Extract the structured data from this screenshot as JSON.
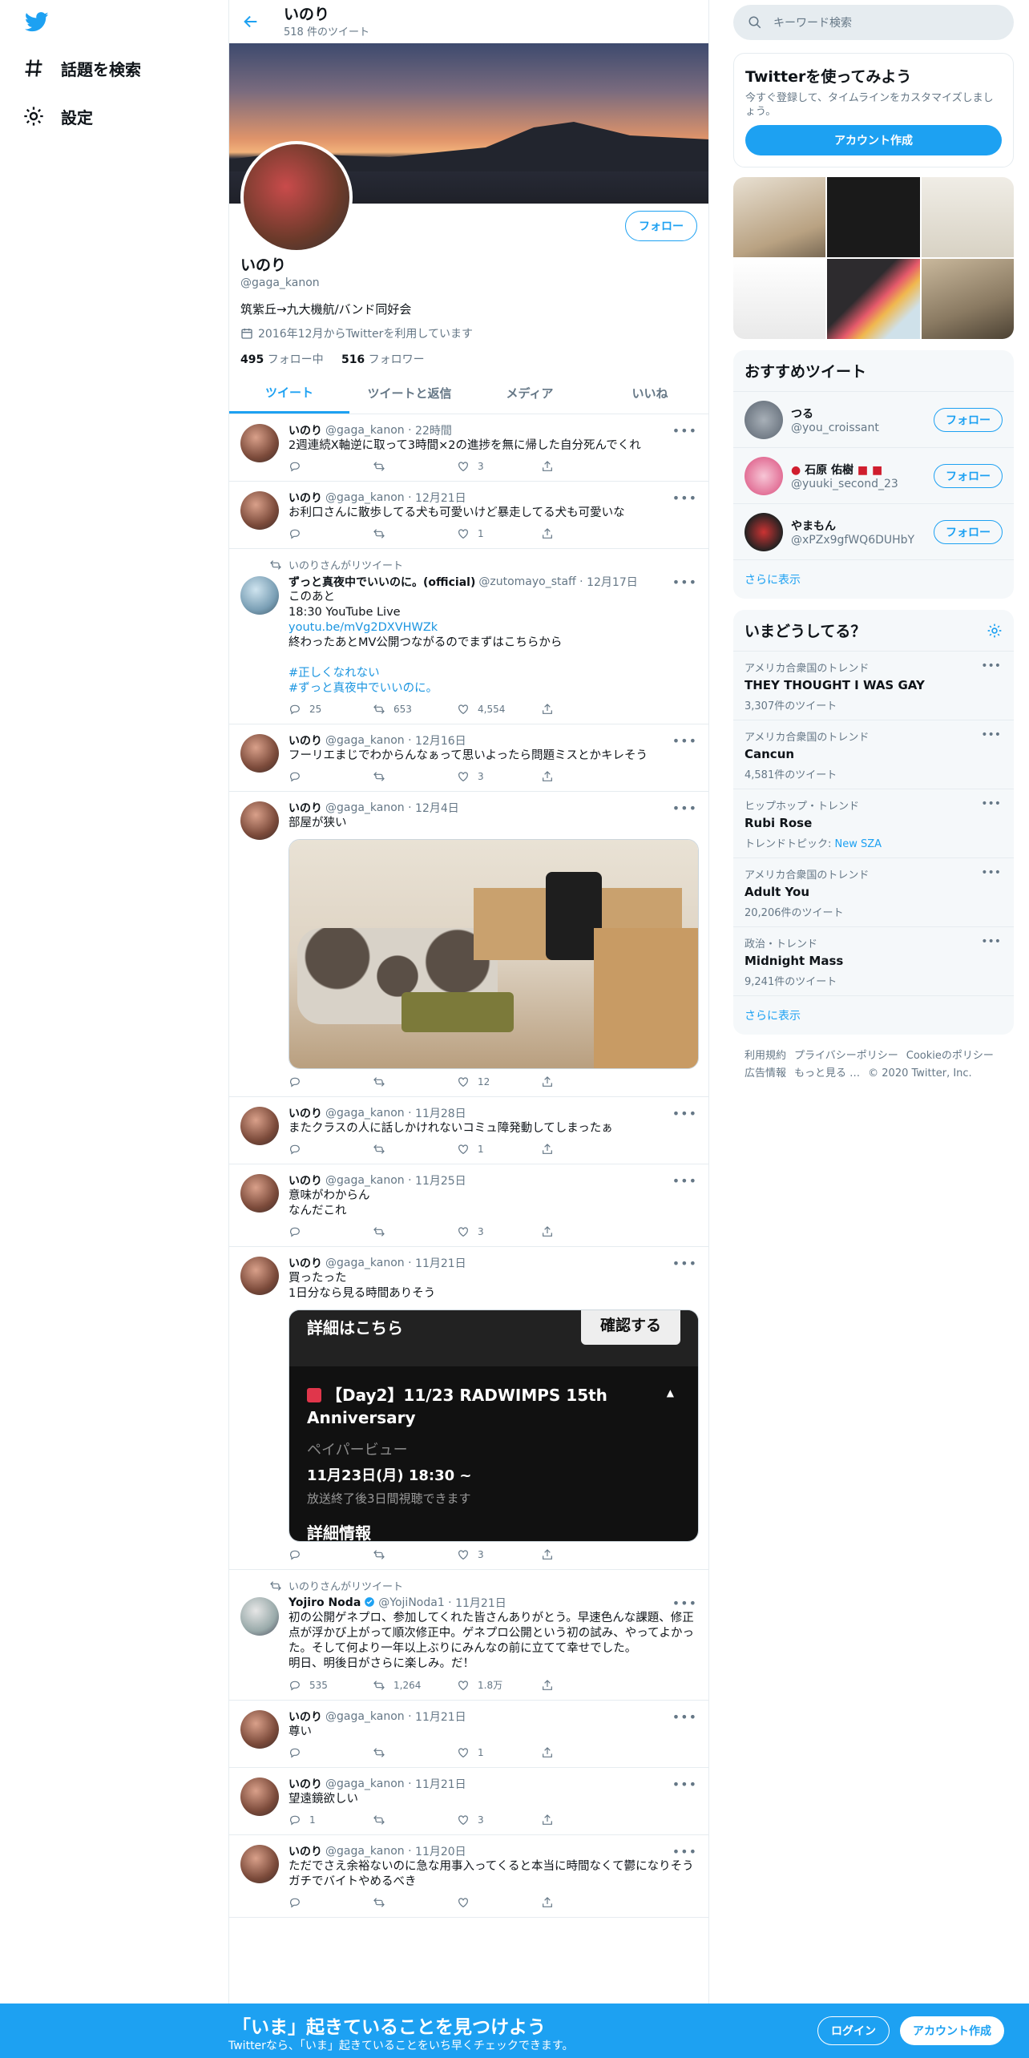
{
  "nav": {
    "explore": "話題を検索",
    "settings": "設定"
  },
  "header": {
    "title": "いのり",
    "subtitle": "518 件のツイート"
  },
  "profile": {
    "name": "いのり",
    "handle": "@gaga_kanon",
    "bio": "筑紫丘→九大機航/バンド同好会",
    "joined": "2016年12月からTwitterを利用しています",
    "following_count": "495",
    "following_label": "フォロー中",
    "followers_count": "516",
    "followers_label": "フォロワー",
    "follow_button": "フォロー"
  },
  "tabs": [
    "ツイート",
    "ツイートと返信",
    "メディア",
    "いいね"
  ],
  "tweets": [
    {
      "name": "いのり",
      "handle": "@gaga_kanon",
      "time": "22時間",
      "text": "2週連続X軸逆に取って3時間×2の進捗を無に帰した自分死んでくれ",
      "replies": "",
      "retweets": "",
      "likes": "3"
    },
    {
      "name": "いのり",
      "handle": "@gaga_kanon",
      "time": "12月21日",
      "text": "お利口さんに散歩してる犬も可愛いけど暴走してる犬も可愛いな",
      "replies": "",
      "retweets": "",
      "likes": "1"
    },
    {
      "retweet_label": "いのりさんがリツイート",
      "name": "ずっと真夜中でいいのに。(official)",
      "handle": "@zutomayo_staff",
      "time": "12月17日",
      "text": "このあと\n18:30 YouTube Live",
      "link": "youtu.be/mVg2DXVHWZk",
      "text2": "\n終わったあとMV公開つながるのでまずはこちらから\n",
      "tag1": "#正しくなれない",
      "tag2": "#ずっと真夜中でいいのに。",
      "replies": "25",
      "retweets": "653",
      "likes": "4,554"
    },
    {
      "name": "いのり",
      "handle": "@gaga_kanon",
      "time": "12月16日",
      "text": "フーリエまじでわからんなぁって思いよったら問題ミスとかキレそう",
      "replies": "",
      "retweets": "",
      "likes": "3"
    },
    {
      "name": "いのり",
      "handle": "@gaga_kanon",
      "time": "12月4日",
      "text": "部屋が狭い",
      "replies": "",
      "retweets": "",
      "likes": "12"
    },
    {
      "name": "いのり",
      "handle": "@gaga_kanon",
      "time": "11月28日",
      "text": "またクラスの人に話しかけれないコミュ障発動してしまったぁ",
      "replies": "",
      "retweets": "",
      "likes": "1"
    },
    {
      "name": "いのり",
      "handle": "@gaga_kanon",
      "time": "11月25日",
      "text": "意味がわからん\nなんだこれ",
      "replies": "",
      "retweets": "",
      "likes": "3"
    },
    {
      "name": "いのり",
      "handle": "@gaga_kanon",
      "time": "11月21日",
      "text": "買ったった\n1日分なら見る時間ありそう",
      "replies": "",
      "retweets": "",
      "likes": "3"
    },
    {
      "retweet_label": "いのりさんがリツイート",
      "name": "Yojiro Noda",
      "handle": "@YojiNoda1",
      "time": "11月21日",
      "text": "初の公開ゲネプロ、参加してくれた皆さんありがとう。早速色んな課題、修正点が浮かび上がって順次修正中。ゲネプロ公開という初の試み、やってよかった。そして何より一年以上ぶりにみんなの前に立てて幸せでした。\n明日、明後日がさらに楽しみ。だ！",
      "replies": "535",
      "retweets": "1,264",
      "likes": "1.8万"
    },
    {
      "name": "いのり",
      "handle": "@gaga_kanon",
      "time": "11月21日",
      "text": "尊い",
      "replies": "",
      "retweets": "",
      "likes": "1"
    },
    {
      "name": "いのり",
      "handle": "@gaga_kanon",
      "time": "11月21日",
      "text": "望遠鏡欲しい",
      "replies": "1",
      "retweets": "",
      "likes": "3"
    },
    {
      "name": "いのり",
      "handle": "@gaga_kanon",
      "time": "11月20日",
      "text": "ただでさえ余裕ないのに急な用事入ってくると本当に時間なくて鬱になりそう\nガチでバイトやめるべき",
      "replies": "",
      "retweets": "",
      "likes": ""
    }
  ],
  "stream_card": {
    "top_left": "詳細はこちら",
    "confirm": "確認する",
    "title": "【Day2】11/23 RADWIMPS 15th Anniversary",
    "ppv": "ペイパービュー",
    "datetime": "11月23日(月) 18:30 ~",
    "note": "放送終了後3日間視聴できます",
    "details": "詳細情報"
  },
  "sidebar": {
    "search_placeholder": "キーワード検索",
    "signup_card": {
      "title": "Twitterを使ってみよう",
      "sub": "今すぐ登録して、タイムラインをカスタマイズしましょう。",
      "button": "アカウント作成"
    },
    "suggest_title": "おすすめツイート",
    "suggestions": [
      {
        "name": "つる",
        "handle": "@you_croissant",
        "button": "フォロー"
      },
      {
        "name": "石原 佑樹",
        "handle": "@yuuki_second_23",
        "button": "フォロー"
      },
      {
        "name": "やまもん",
        "handle": "@xPZx9gfWQ6DUHbY",
        "button": "フォロー"
      }
    ],
    "show_more": "さらに表示",
    "trends_title": "いまどうしてる？",
    "trends": [
      {
        "category": "アメリカ合衆国のトレンド",
        "name": "THEY THOUGHT I WAS GAY",
        "count": "3,307件のツイート"
      },
      {
        "category": "アメリカ合衆国のトレンド",
        "name": "Cancun",
        "count": "4,581件のツイート"
      },
      {
        "category": "ヒップホップ・トレンド",
        "name": "Rubi Rose",
        "count": "トレンドトピック: ",
        "topic": "New SZA"
      },
      {
        "category": "アメリカ合衆国のトレンド",
        "name": "Adult You",
        "count": "20,206件のツイート"
      },
      {
        "category": "政治・トレンド",
        "name": "Midnight Mass",
        "count": "9,241件のツイート"
      }
    ],
    "footer": [
      "利用規約",
      "プライバシーポリシー",
      "Cookieのポリシー",
      "広告情報",
      "もっと見る …",
      "© 2020 Twitter, Inc."
    ]
  },
  "bottom_bar": {
    "headline": "「いま」起きていることを見つけよう",
    "sub": "Twitterなら、「いま」起きていることをいち早くチェックできます。",
    "login": "ログイン",
    "signup": "アカウント作成"
  }
}
